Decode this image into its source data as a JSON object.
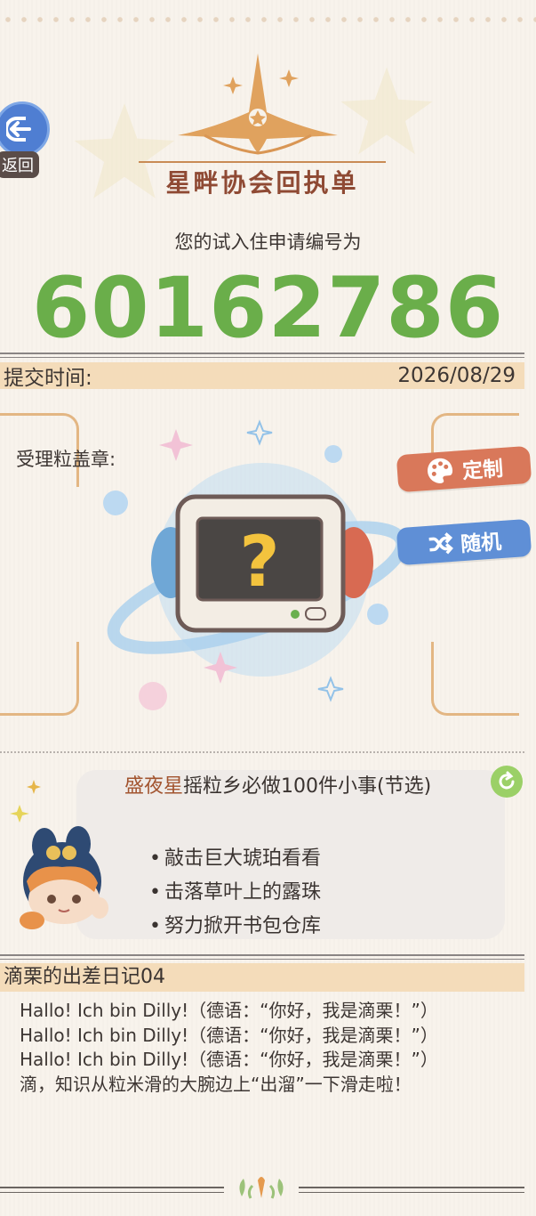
{
  "nav": {
    "back_label": "返回"
  },
  "header": {
    "logo_text": "星畔协会回执单",
    "subtitle": "您的试入住申请编号为",
    "application_number": "60162786"
  },
  "submit": {
    "label": "提交时间:",
    "date": "2026/08/29"
  },
  "stamp": {
    "label": "受理粒盖章:",
    "custom_button": "定制",
    "random_button": "随机",
    "placeholder_glyph": "?"
  },
  "event": {
    "name_highlight": "盛夜星",
    "title_rest": "摇粒乡必做100件小事(节选)",
    "items": [
      "敲击巨大琥珀看看",
      "击落草叶上的露珠",
      "努力掀开书包仓库"
    ]
  },
  "diary": {
    "title": "滴栗的出差日记04",
    "lines": [
      "Hallo! Ich bin Dilly!（德语：“你好，我是滴栗！”）",
      "Hallo! Ich bin Dilly!（德语：“你好，我是滴栗！”）",
      "Hallo! Ich bin Dilly!（德语：“你好，我是滴栗！”）",
      "滴，知识从粒米滑的大腕边上“出溜”一下滑走啦！"
    ]
  },
  "colors": {
    "accent_green": "#6aae4a",
    "brand_brown": "#8f4a34",
    "bar_bg": "#f4dcba",
    "custom_btn": "#d9785a",
    "random_btn": "#5f8fd6"
  }
}
